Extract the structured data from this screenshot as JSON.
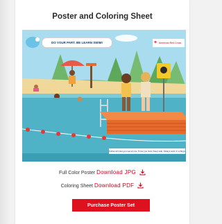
{
  "card": {
    "title": "Poster and Coloring Sheet"
  },
  "poster": {
    "speech_bubble": "DO YOUR PART. BE LEARN SWIM!",
    "brand": "American Red Cross",
    "footer_note": "Follow all rules you see at one. Know you swim Keep safe. Always swim in a lifeguard area.",
    "colors": {
      "sky": "#a8dcee",
      "water": "#4fb2c6",
      "sand": "#f0d79a",
      "raft": "#e56a2c"
    }
  },
  "downloads": [
    {
      "label": "Full Color Poster",
      "link": "Download JPG",
      "icon": "download-icon"
    },
    {
      "label": "Coloring Sheet",
      "link": "Download PDF",
      "icon": "download-icon"
    }
  ],
  "purchase_button": {
    "label": "Purchase Poster Set",
    "color": "#e0111e"
  }
}
